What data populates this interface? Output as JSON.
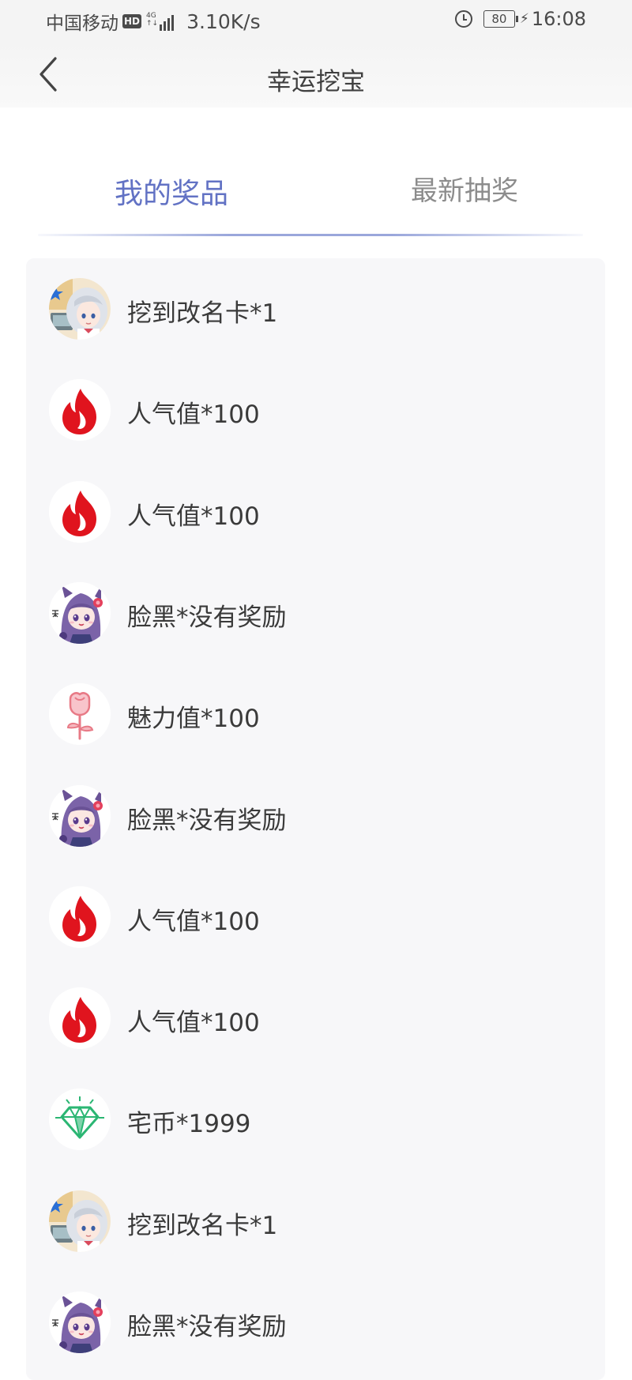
{
  "status_bar": {
    "carrier": "中国移动",
    "hd_badge": "HD",
    "network_type_top": "4G",
    "network_type_bottom": "↑↓",
    "net_speed": "3.10K/s",
    "battery_level": "80",
    "time": "16:08"
  },
  "header": {
    "title": "幸运挖宝",
    "back_icon": "chevron-left-icon"
  },
  "tabs": [
    {
      "label": "我的奖品",
      "active": true
    },
    {
      "label": "最新抽奖",
      "active": false
    }
  ],
  "colors": {
    "accent": "#6272c4",
    "fire": "#e0141e",
    "rose": "#e87a86",
    "diamond": "#2bb673",
    "card_bg": "#f7f7f9"
  },
  "prizes": [
    {
      "icon": "anime-girl-silver-hair-avatar",
      "label": "挖到改名卡*1"
    },
    {
      "icon": "fire-icon",
      "label": "人气值*100"
    },
    {
      "icon": "fire-icon",
      "label": "人气值*100"
    },
    {
      "icon": "anime-girl-purple-hair-avatar",
      "label": "脸黑*没有奖励"
    },
    {
      "icon": "rose-icon",
      "label": "魅力值*100"
    },
    {
      "icon": "anime-girl-purple-hair-avatar",
      "label": "脸黑*没有奖励"
    },
    {
      "icon": "fire-icon",
      "label": "人气值*100"
    },
    {
      "icon": "fire-icon",
      "label": "人气值*100"
    },
    {
      "icon": "diamond-icon",
      "label": "宅币*1999"
    },
    {
      "icon": "anime-girl-silver-hair-avatar",
      "label": "挖到改名卡*1"
    },
    {
      "icon": "anime-girl-purple-hair-avatar",
      "label": "脸黑*没有奖励"
    }
  ]
}
